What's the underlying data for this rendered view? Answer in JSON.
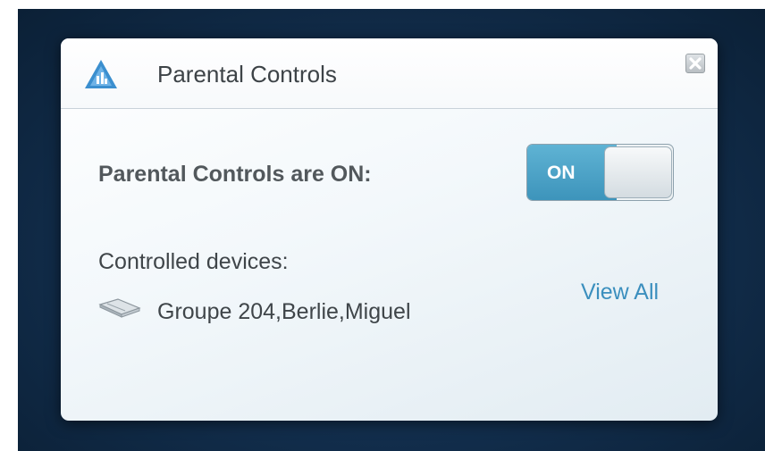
{
  "widget": {
    "title": "Parental Controls",
    "logo_icon": "linksys-triangle-icon",
    "close_icon": "close-box-icon"
  },
  "status": {
    "label": "Parental Controls are ON:",
    "toggle_label": "ON",
    "toggle_state": "on",
    "accent_color": "#3d94bb"
  },
  "devices": {
    "label": "Controlled devices:",
    "device_icon": "network-device-icon",
    "names": "Groupe 204,Berlie,Miguel",
    "view_all_label": "View All",
    "link_color": "#3b8fbe"
  }
}
